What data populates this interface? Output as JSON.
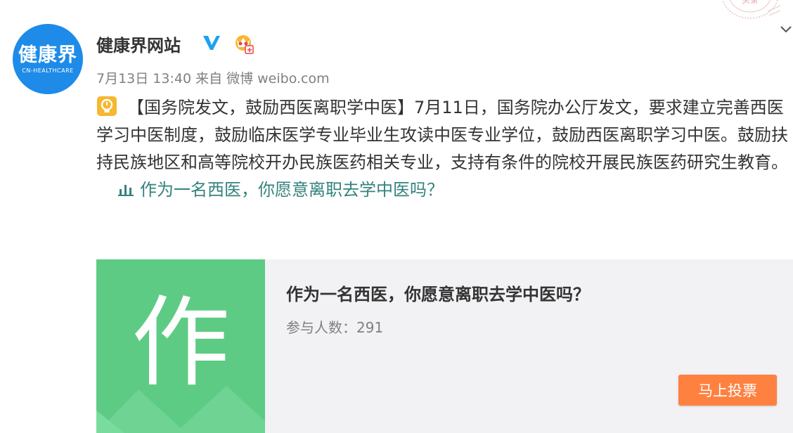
{
  "post": {
    "avatar": {
      "line1": "健康界",
      "line2": "CN-HEALTHCARE"
    },
    "username": "健康界网站",
    "time": "7月13日 13:40",
    "source": "来自 微博 weibo.com",
    "topic": "【国务院发文，鼓励西医离职学中医】",
    "body": "7月11日，国务院办公厅发文，要求建立完善西医学习中医制度，鼓励临床医学专业毕业生攻读中医专业学位，鼓励西医离职学习中医。鼓励扶持民族地区和高等院校开办民族医药相关专业，支持有条件的院校开展民族医药研究生教育。",
    "vote_link": "作为一名西医，你愿意离职去学中医吗？"
  },
  "card": {
    "thumb_char": "作",
    "title": "作为一名西医，你愿意离职去学中医吗？",
    "count": "参与人数：291",
    "button": "马上投票"
  },
  "stamp": {
    "text": "头条"
  },
  "colors": {
    "avatar_bg": "#1e8be8",
    "link": "#35827c",
    "button": "#ff8140",
    "thumb": "#5ecb85"
  },
  "icons": [
    "verified-icon",
    "crown-icon",
    "lightbulb-icon",
    "poll-icon",
    "chevron-down-icon"
  ]
}
